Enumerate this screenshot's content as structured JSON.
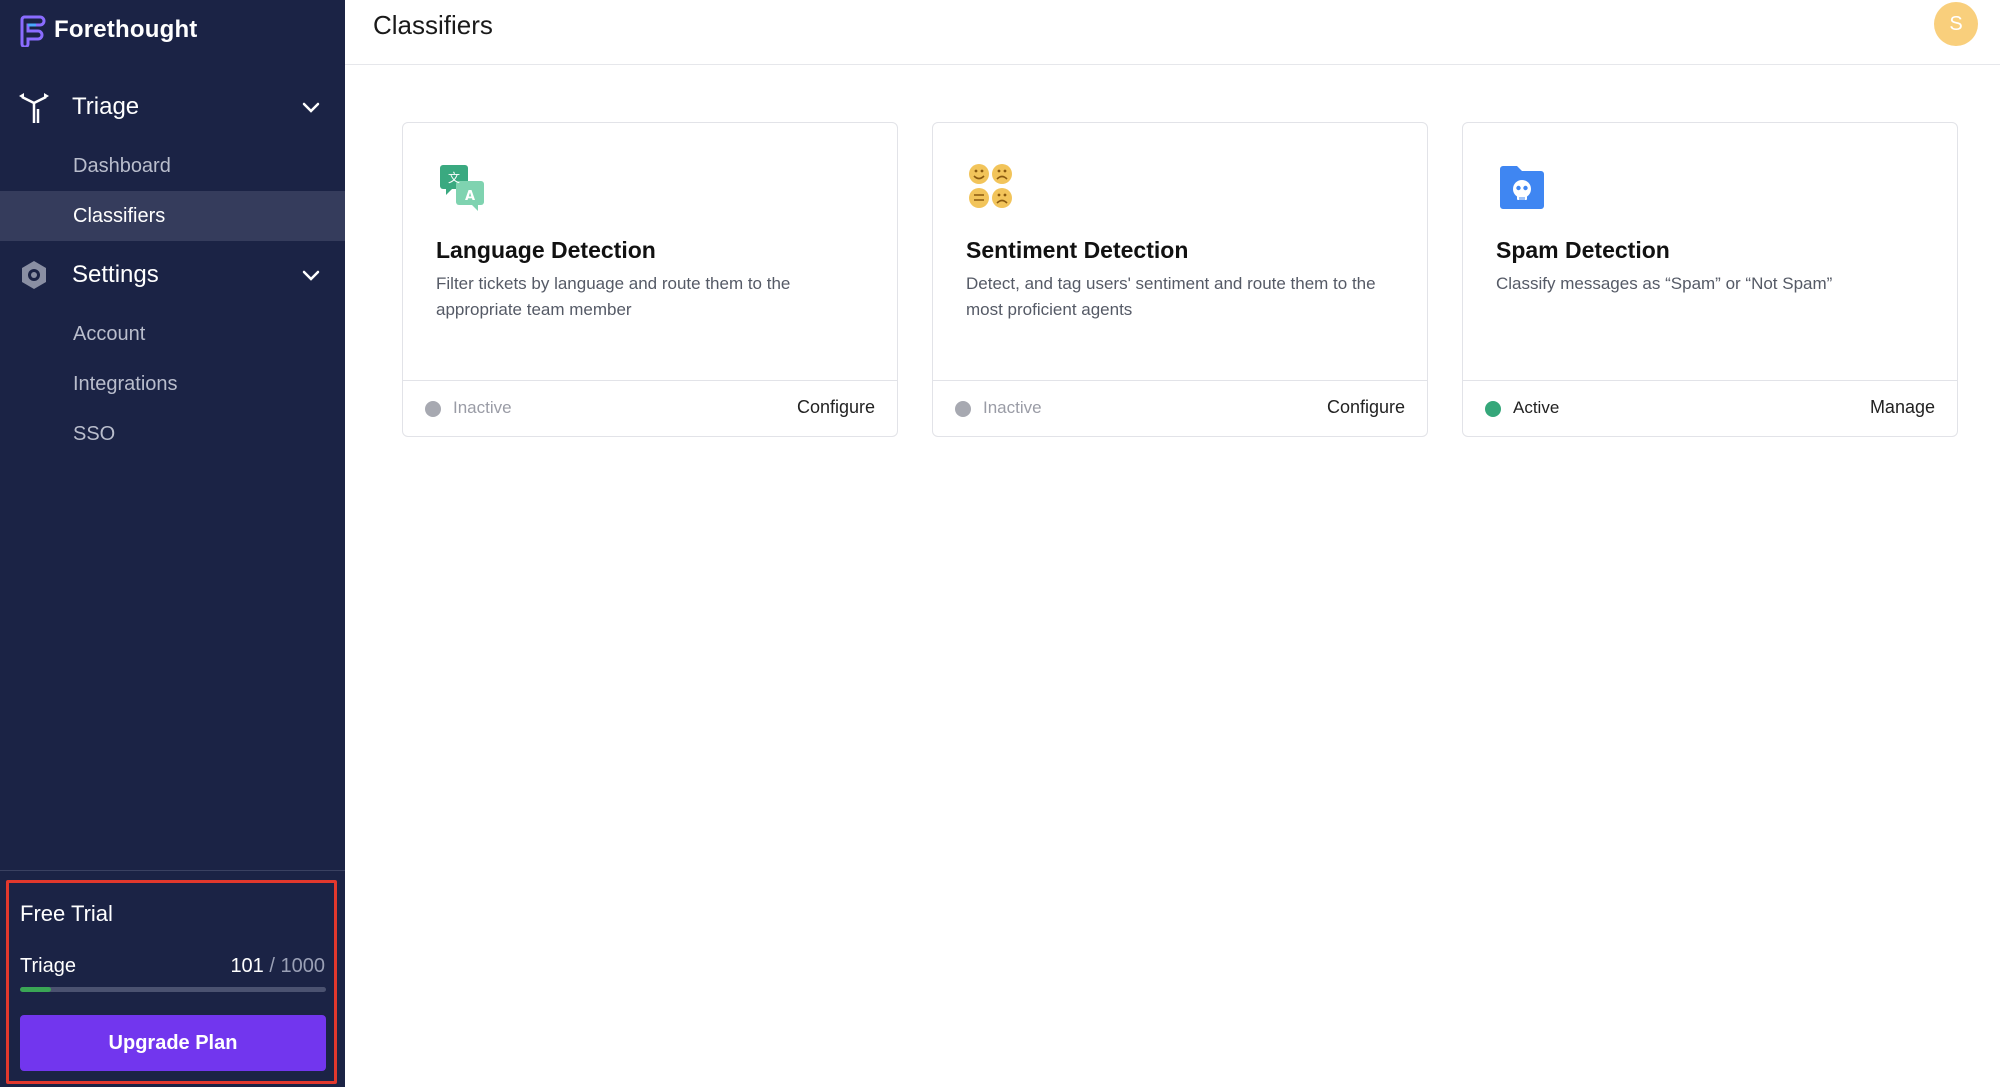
{
  "app": {
    "name": "Forethought"
  },
  "sidebar": {
    "groups": [
      {
        "label": "Triage",
        "icon": "triage-icon",
        "items": [
          {
            "label": "Dashboard",
            "active": false
          },
          {
            "label": "Classifiers",
            "active": true
          }
        ]
      },
      {
        "label": "Settings",
        "icon": "settings-icon",
        "items": [
          {
            "label": "Account",
            "active": false
          },
          {
            "label": "Integrations",
            "active": false
          },
          {
            "label": "SSO",
            "active": false
          }
        ]
      }
    ],
    "trial": {
      "title": "Free Trial",
      "usage_label": "Triage",
      "used": "101",
      "separator": "/",
      "limit": "1000",
      "progress_fraction": 0.101,
      "upgrade_label": "Upgrade Plan"
    }
  },
  "header": {
    "title": "Classifiers",
    "avatar_initial": "S"
  },
  "cards": [
    {
      "icon": "language-translate-icon",
      "title": "Language Detection",
      "description": "Filter tickets by language and route them to the appropriate team member",
      "status": "Inactive",
      "action": "Configure"
    },
    {
      "icon": "sentiment-faces-icon",
      "title": "Sentiment Detection",
      "description": "Detect, and tag users' sentiment and route them to the most proficient agents",
      "status": "Inactive",
      "action": "Configure"
    },
    {
      "icon": "spam-folder-icon",
      "title": "Spam Detection",
      "description": "Classify messages as “Spam” or “Not Spam”",
      "status": "Active",
      "action": "Manage"
    }
  ],
  "colors": {
    "sidebar_bg": "#1b2345",
    "accent_purple": "#7236ee",
    "active_green": "#35a77a",
    "progress_green": "#3aa655",
    "highlight_red": "#e2382d",
    "avatar_yellow": "#f9cf7c"
  }
}
